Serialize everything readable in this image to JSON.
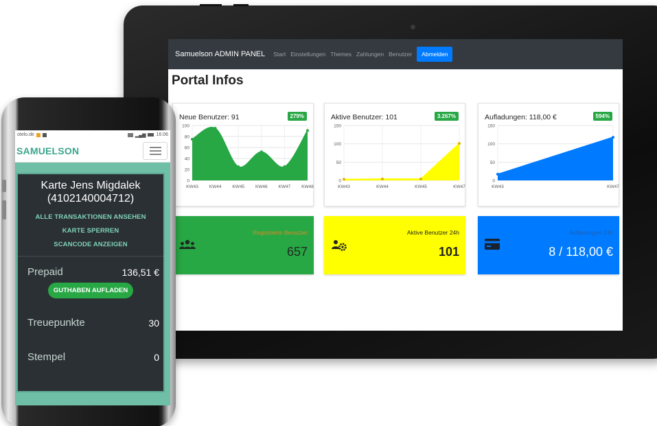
{
  "admin": {
    "brand": "Samuelson ADMIN PANEL",
    "nav": [
      "Start",
      "Einstellungen",
      "Themes",
      "Zahlungen",
      "Benutzer"
    ],
    "logout": "Abmelden",
    "page_title": "Portal Infos",
    "cards": [
      {
        "title": "Neue Benutzer: 91",
        "badge": "279%"
      },
      {
        "title": "Aktive Benutzer: 101",
        "badge": "3.267%"
      },
      {
        "title": "Aufladungen: 118,00 €",
        "badge": "594%"
      }
    ],
    "stats": [
      {
        "label": "Registrierte Benutzer",
        "value": "657",
        "icon": "users-icon"
      },
      {
        "label": "Aktive Benutzer 24h",
        "value": "101",
        "icon": "users-gear-icon"
      },
      {
        "label": "Aufladungen 24h",
        "value": "8 / 118,00 €",
        "icon": "credit-card-icon"
      }
    ]
  },
  "colors": {
    "green": "#28a745",
    "yellow": "#ffff00",
    "blue": "#007bff",
    "navbar": "#343a40",
    "accent": "#3aa58c"
  },
  "chart_data": [
    {
      "type": "area",
      "title": "Neue Benutzer: 91",
      "categories": [
        "KW43",
        "KW44",
        "KW45",
        "KW46",
        "KW47",
        "KW48"
      ],
      "values": [
        75,
        95,
        25,
        52,
        25,
        91
      ],
      "yticks": [
        "0",
        "20",
        "40",
        "60",
        "80",
        "100"
      ],
      "ylim": [
        0,
        100
      ],
      "color": "#28a745"
    },
    {
      "type": "area",
      "title": "Aktive Benutzer: 101",
      "categories": [
        "KW43",
        "KW44",
        "KW45",
        "KW47"
      ],
      "x": [
        0,
        1,
        2,
        3
      ],
      "values": [
        3,
        4,
        4,
        101
      ],
      "yticks": [
        "0",
        "50",
        "100",
        "150"
      ],
      "ylim": [
        0,
        150
      ],
      "color": "#ffff00"
    },
    {
      "type": "area",
      "title": "Aufladungen: 118,00 €",
      "categories": [
        "KW43",
        "KW47"
      ],
      "values": [
        17,
        118
      ],
      "yticks": [
        "0",
        "50",
        "100",
        "150"
      ],
      "ylim": [
        0,
        150
      ],
      "color": "#007bff"
    }
  ],
  "phone": {
    "status_left": "otelo.de",
    "status_right": "16:06",
    "brand": "SAMUELSON",
    "card_name": "Karte Jens Migdalek",
    "card_number": "(4102140004712)",
    "links": [
      "ALLE TRANSAKTIONEN ANSEHEN",
      "KARTE SPERREN",
      "SCANCODE ANZEIGEN"
    ],
    "prepaid_label": "Prepaid",
    "prepaid_value": "136,51 €",
    "topup_label": "GUTHABEN AUFLADEN",
    "points_label": "Treuepunkte",
    "points_value": "30",
    "stamps_label": "Stempel",
    "stamps_value": "0"
  }
}
